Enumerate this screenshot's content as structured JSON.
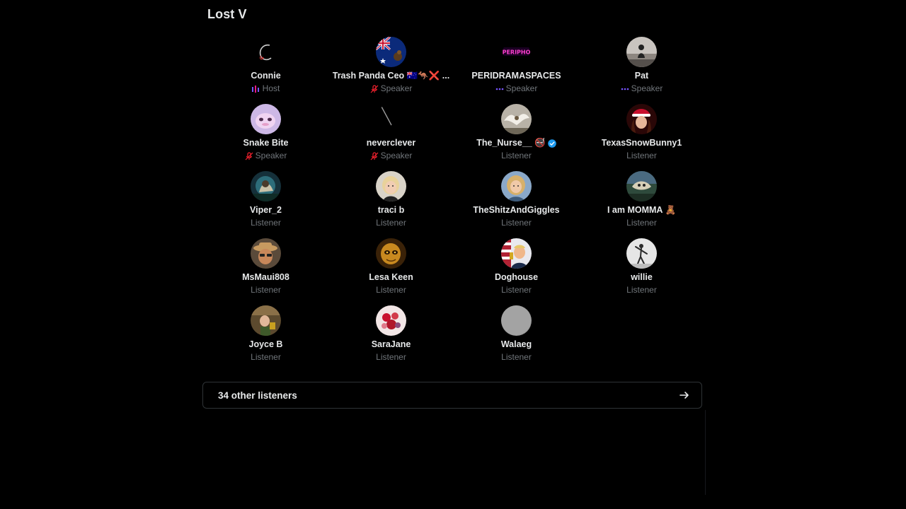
{
  "space": {
    "title": "Lost V"
  },
  "participants": [
    {
      "name": "Connie",
      "role": "Host",
      "role_icon": "host-bars-icon",
      "avatar": "script-c-logo"
    },
    {
      "name": "Trash Panda Ceo 🇦🇺🦘❌ ...",
      "role": "Speaker",
      "role_icon": "muted-mic-icon",
      "avatar": "australian-flag"
    },
    {
      "name": "PERIDRAMASPACES",
      "role": "Speaker",
      "role_icon": "speaking-dots-icon",
      "avatar": "neon-logo"
    },
    {
      "name": "Pat",
      "role": "Speaker",
      "role_icon": "speaking-dots-icon",
      "avatar": "silhouette-sky"
    },
    {
      "name": "Snake Bite",
      "role": "Speaker",
      "role_icon": "muted-mic-icon",
      "avatar": "pink-creature"
    },
    {
      "name": "neverclever",
      "role": "Speaker",
      "role_icon": "muted-mic-icon",
      "avatar": "needle-line"
    },
    {
      "name": "The_Nurse__ 🚭",
      "role": "Listener",
      "role_icon": "",
      "avatar": "eagle-photo",
      "verified": true
    },
    {
      "name": "TexasSnowBunny1",
      "role": "Listener",
      "role_icon": "",
      "avatar": "santa-hat-woman"
    },
    {
      "name": "Viper_2",
      "role": "Listener",
      "role_icon": "",
      "avatar": "teal-forest"
    },
    {
      "name": "traci b",
      "role": "Listener",
      "role_icon": "",
      "avatar": "blonde-woman"
    },
    {
      "name": "TheShitzAndGiggles",
      "role": "Listener",
      "role_icon": "",
      "avatar": "woman-portrait"
    },
    {
      "name": "I am MOMMA 🧸",
      "role": "Listener",
      "role_icon": "",
      "avatar": "owl-photo"
    },
    {
      "name": "MsMaui808",
      "role": "Listener",
      "role_icon": "",
      "avatar": "hat-memoji"
    },
    {
      "name": "Lesa Keen",
      "role": "Listener",
      "role_icon": "",
      "avatar": "golden-face"
    },
    {
      "name": "Doghouse",
      "role": "Listener",
      "role_icon": "",
      "avatar": "flag-portrait"
    },
    {
      "name": "willie",
      "role": "Listener",
      "role_icon": "",
      "avatar": "golfer-silhouette"
    },
    {
      "name": "Joyce B",
      "role": "Listener",
      "role_icon": "",
      "avatar": "indoor-photo"
    },
    {
      "name": "SaraJane",
      "role": "Listener",
      "role_icon": "",
      "avatar": "red-flowers"
    },
    {
      "name": "Walaeg",
      "role": "Listener",
      "role_icon": "",
      "avatar": "grey-default"
    }
  ],
  "footer": {
    "label": "34 other listeners",
    "icon": "arrow-right-icon"
  },
  "colors": {
    "background": "#000000",
    "text_primary": "#e7e9ea",
    "text_secondary": "#71767b",
    "verified": "#1d9bf0",
    "muted_mic": "#f4212e",
    "speaking_dots": "#7856ff",
    "border": "#2f3336"
  }
}
